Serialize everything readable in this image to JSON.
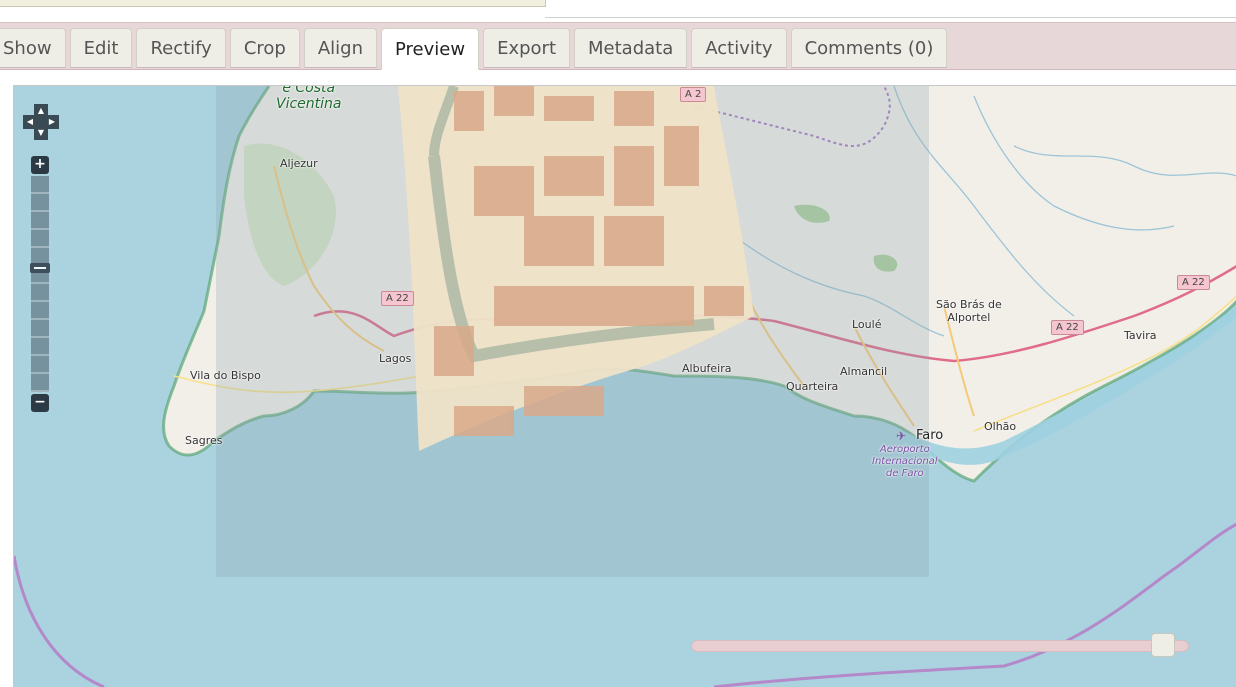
{
  "tabs": [
    {
      "label": "Show",
      "active": false
    },
    {
      "label": "Edit",
      "active": false
    },
    {
      "label": "Rectify",
      "active": false
    },
    {
      "label": "Crop",
      "active": false
    },
    {
      "label": "Align",
      "active": false
    },
    {
      "label": "Preview",
      "active": true
    },
    {
      "label": "Export",
      "active": false
    },
    {
      "label": "Metadata",
      "active": false
    },
    {
      "label": "Activity",
      "active": false
    },
    {
      "label": "Comments (0)",
      "active": false
    }
  ],
  "map": {
    "labels": {
      "costa_vicentina": "e Costa\nVicentina",
      "aljezur": "Aljezur",
      "vila_do_bispo": "Vila do Bispo",
      "sagres": "Sagres",
      "lagos": "Lagos",
      "albufeira": "Albufeira",
      "quarteira": "Quarteira",
      "almancil": "Almancil",
      "loule": "Loulé",
      "sao_bras": "São Brás de\nAlportel",
      "tavira": "Tavira",
      "olhao": "Olhão",
      "faro": "Faro",
      "airport": "Aeroporto\nInternacional\nde Faro"
    },
    "road_shields": {
      "a22_west": "A 22",
      "a2": "A 2",
      "a22_mid": "A 22",
      "a22_east": "A 22"
    },
    "zoom_controls": {
      "plus": "+",
      "minus": "−"
    },
    "zoom_level_fraction": 0.58,
    "overlay_opacity": 0.97
  },
  "colors": {
    "sea": "#aad3df",
    "land": "#f2efe9",
    "tab_bar": "#e8d7d9",
    "old_map": "#efe3c8"
  }
}
